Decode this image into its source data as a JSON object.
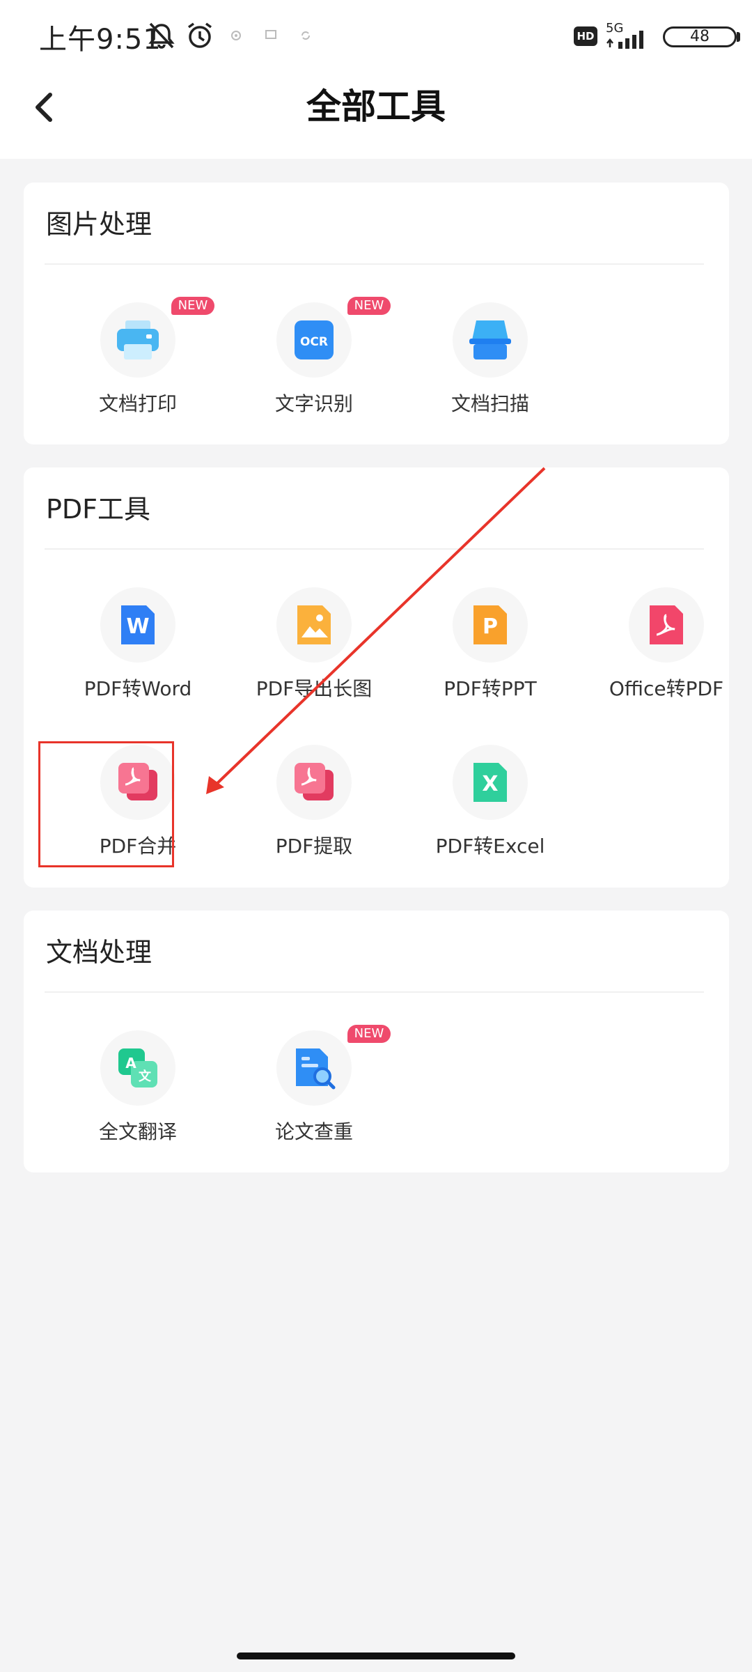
{
  "status_bar": {
    "time": "上午9:51",
    "network_badge": "HD",
    "network_type": "5G",
    "battery": "48",
    "icons": [
      "mute-icon",
      "alarm-icon",
      "notification-dot-icon",
      "cast-icon",
      "sync-icon",
      "signal-icon"
    ]
  },
  "header": {
    "title": "全部工具",
    "back_icon": "back-arrow-icon"
  },
  "sections": [
    {
      "title": "图片处理",
      "tools": [
        {
          "label": "文档打印",
          "icon": "printer-icon",
          "badge": "NEW"
        },
        {
          "label": "文字识别",
          "icon": "ocr-icon",
          "icon_text": "OCR",
          "badge": "NEW"
        },
        {
          "label": "文档扫描",
          "icon": "scanner-icon"
        }
      ]
    },
    {
      "title": "PDF工具",
      "tools": [
        {
          "label": "PDF转Word",
          "icon": "word-icon",
          "icon_text": "W"
        },
        {
          "label": "PDF导出长图",
          "icon": "image-icon"
        },
        {
          "label": "PDF转PPT",
          "icon": "ppt-icon",
          "icon_text": "P"
        },
        {
          "label": "Office转PDF",
          "icon": "pdf-icon"
        },
        {
          "label": "PDF合并",
          "icon": "pdf-merge-icon"
        },
        {
          "label": "PDF提取",
          "icon": "pdf-extract-icon"
        },
        {
          "label": "PDF转Excel",
          "icon": "excel-icon",
          "icon_text": "X"
        }
      ]
    },
    {
      "title": "文档处理",
      "tools": [
        {
          "label": "全文翻译",
          "icon": "translate-icon",
          "icon_text": "A",
          "icon_text2": "文"
        },
        {
          "label": "论文查重",
          "icon": "plagiarism-check-icon",
          "badge": "NEW"
        }
      ]
    }
  ],
  "colors": {
    "accent_badge": "#ef4a6c",
    "highlight": "#e8342a",
    "card_background": "#ffffff",
    "page_background": "#f4f4f5"
  }
}
